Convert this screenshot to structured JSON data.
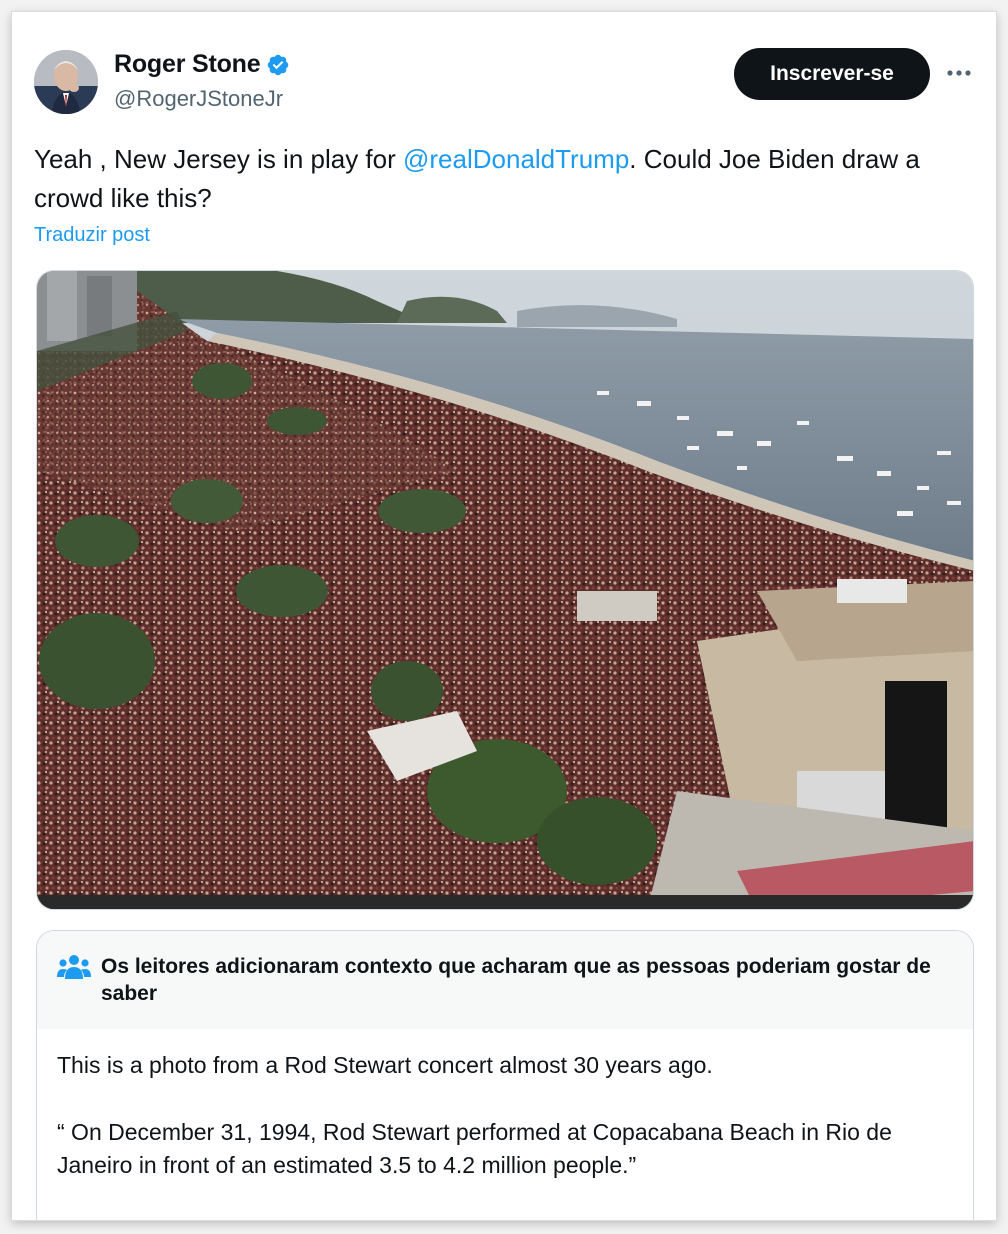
{
  "author": {
    "display_name": "Roger Stone",
    "handle": "@RogerJStoneJr",
    "verified_icon": "verified-badge-icon",
    "avatar": "user-avatar"
  },
  "header": {
    "subscribe_label": "Inscrever-se",
    "more_icon": "more-options-icon"
  },
  "tweet": {
    "text_before": "Yeah , New Jersey is in play for ",
    "mention": "@realDonaldTrump",
    "text_after": ". Could Joe Biden draw a crowd like this?",
    "translate_label": "Traduzir post"
  },
  "media": {
    "description_icon": "aerial-crowd-beach-photo"
  },
  "community_note": {
    "icon": "people-icon",
    "title": "Os leitores adicionaram contexto que acharam que as pessoas poderiam gostar de saber",
    "paragraph_1": "This is a photo from a Rod Stewart concert almost 30 years ago.",
    "paragraph_2": "“ On December 31, 1994, Rod Stewart performed at Copacabana Beach in Rio de Janeiro in front of an estimated 3.5 to 4.2 million people.”"
  },
  "colors": {
    "accent": "#1d9bf0",
    "text": "#0f1419",
    "secondary_text": "#536471",
    "button_bg": "#0f1419",
    "note_header_bg": "#f7f9f9"
  }
}
